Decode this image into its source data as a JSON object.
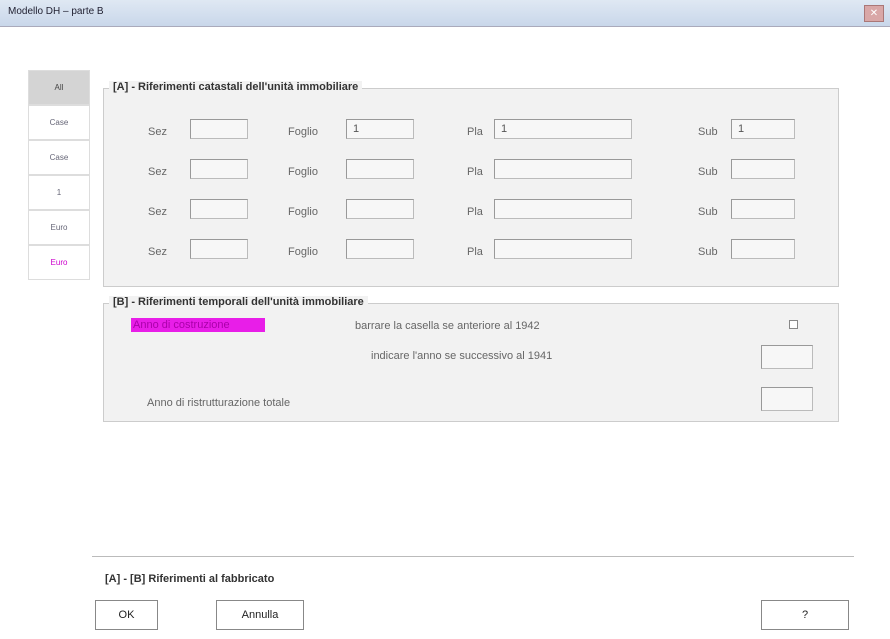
{
  "window": {
    "title": "Modello DH – parte B",
    "close_glyph": "✕"
  },
  "tabs": [
    {
      "label": "All"
    },
    {
      "label": "Case"
    },
    {
      "label": "Case"
    },
    {
      "label": "1"
    },
    {
      "label": "Euro"
    },
    {
      "label": "Euro"
    }
  ],
  "section_a": {
    "legend": "[A] - Riferimenti catastali dell'unità immobiliare",
    "labels": {
      "sez": "Sez",
      "foglio": "Foglio",
      "pla": "Pla",
      "sub": "Sub"
    },
    "rows": [
      {
        "sez": "",
        "foglio": "1",
        "pla": "1",
        "sub": "1"
      },
      {
        "sez": "",
        "foglio": "",
        "pla": "",
        "sub": ""
      },
      {
        "sez": "",
        "foglio": "",
        "pla": "",
        "sub": ""
      },
      {
        "sez": "",
        "foglio": "",
        "pla": "",
        "sub": ""
      }
    ]
  },
  "section_b": {
    "legend": "[B] - Riferimenti temporali dell'unità immobiliare",
    "highlight_label": "Anno di costruzione",
    "line1": "barrare la casella se anteriore al 1942",
    "line2": "indicare l'anno se successivo al 1941",
    "line3": "Anno di ristrutturazione totale",
    "anno_costruzione_value": "",
    "anno_ristrutturazione_value": ""
  },
  "footer": {
    "text": "[A] - [B] Riferimenti al fabbricato",
    "ok": "OK",
    "annulla": "Annulla",
    "help": "?"
  }
}
